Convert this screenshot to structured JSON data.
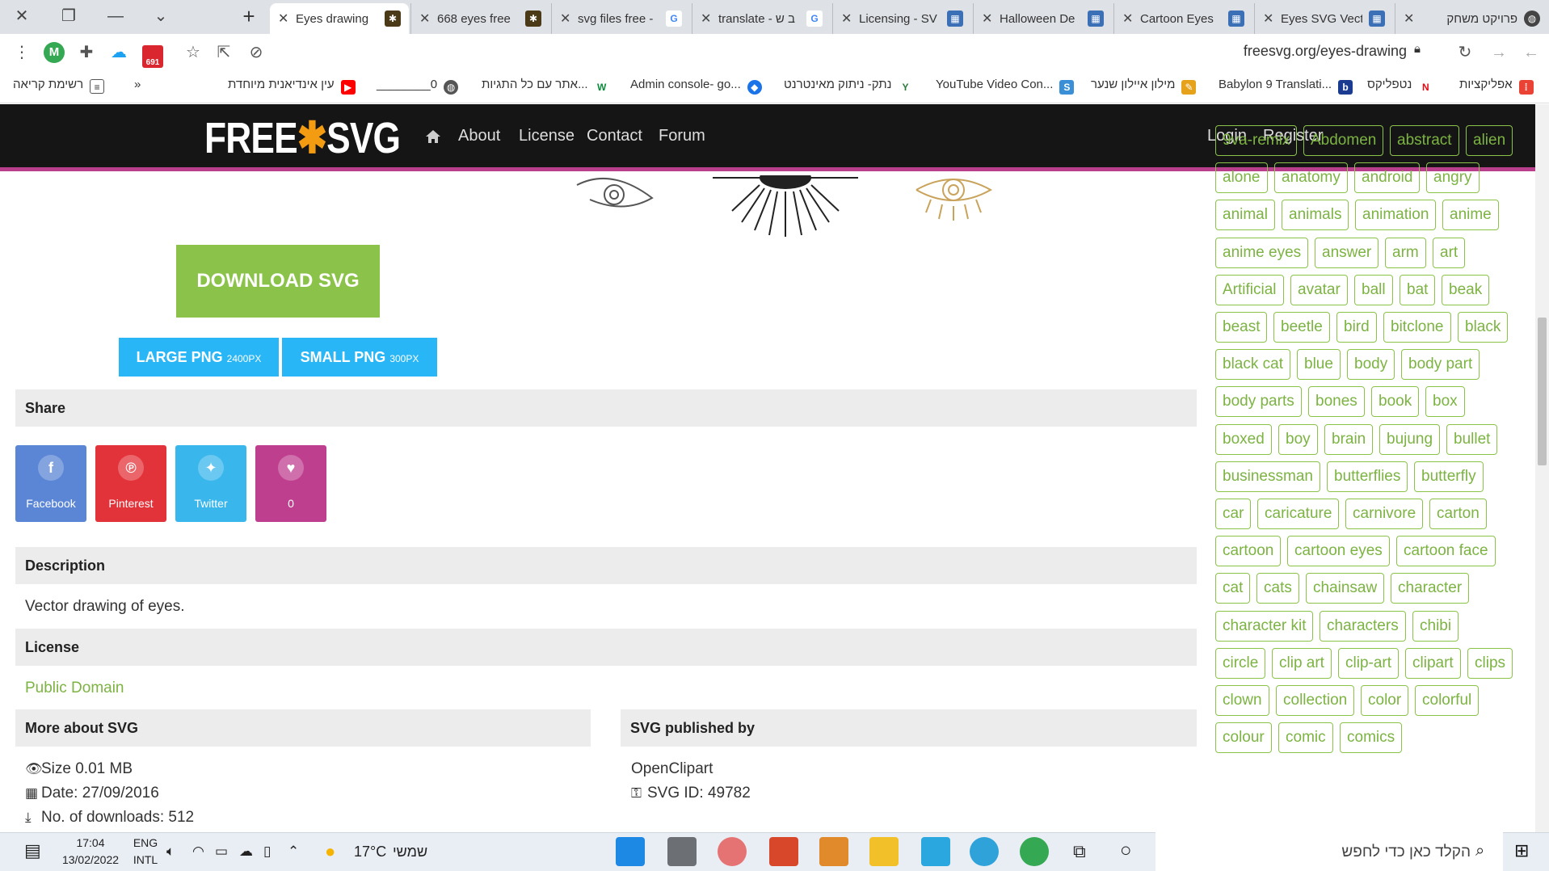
{
  "browser": {
    "tabs": [
      {
        "title": "Eyes drawing",
        "active": true
      },
      {
        "title": "668 eyes free",
        "active": false
      },
      {
        "title": "svg files free -",
        "active": false
      },
      {
        "title": "translate - ב ש",
        "active": false
      },
      {
        "title": "Licensing - SV",
        "active": false
      },
      {
        "title": "Halloween De",
        "active": false
      },
      {
        "title": "Cartoon Eyes",
        "active": false
      },
      {
        "title": "Eyes SVG Vect",
        "active": false
      },
      {
        "title": "פרויקט משחק",
        "active": false
      }
    ],
    "url": "freesvg.org/eyes-drawing",
    "extension_badge": "691",
    "profile_letter": "M",
    "bookmarks": [
      {
        "label": "אפליקציות"
      },
      {
        "label": "נטפליקס"
      },
      {
        "label": "Babylon 9 Translati..."
      },
      {
        "label": "מילון איילון שנער"
      },
      {
        "label": "YouTube Video Con..."
      },
      {
        "label": "נתק- ניתוק מאינטרנט"
      },
      {
        "label": "Admin console- go..."
      },
      {
        "label": "אתר עם כל התגיות..."
      },
      {
        "label": "________0"
      },
      {
        "label": "עין אינדיאנית מיוחדת"
      },
      {
        "label": "»"
      },
      {
        "label": "רשימת קריאה"
      }
    ]
  },
  "site": {
    "logo_left": "FREE",
    "logo_star": "✱",
    "logo_right": "SVG",
    "nav": {
      "about": "About",
      "license": "License",
      "contact": "Contact",
      "forum": "Forum",
      "login": "Login",
      "register": "Register"
    }
  },
  "downloads": {
    "download_svg": "DOWNLOAD SVG",
    "large_png": "LARGE PNG",
    "large_png_size": "2400PX",
    "small_png": "SMALL PNG",
    "small_png_size": "300PX"
  },
  "share": {
    "heading": "Share",
    "facebook": "Facebook",
    "pinterest": "Pinterest",
    "twitter": "Twitter",
    "likes": "0"
  },
  "description": {
    "heading": "Description",
    "text": "Vector drawing of eyes."
  },
  "license": {
    "heading": "License",
    "value": "Public Domain"
  },
  "more_about": {
    "heading": "More about SVG",
    "size": "Size 0.01 MB",
    "date": "Date: 27/09/2016",
    "downloads": "No. of downloads: 512"
  },
  "published_by": {
    "heading": "SVG published by",
    "author": "OpenClipart",
    "svg_id": "SVG ID: 49782"
  },
  "tags": [
    "9va-remix",
    "Abdomen",
    "abstract",
    "alien",
    "alone",
    "anatomy",
    "android",
    "angry",
    "animal",
    "animals",
    "animation",
    "anime",
    "anime eyes",
    "answer",
    "arm",
    "art",
    "Artificial",
    "avatar",
    "ball",
    "bat",
    "beak",
    "beast",
    "beetle",
    "bird",
    "bitclone",
    "black",
    "black cat",
    "blue",
    "body",
    "body part",
    "body parts",
    "bones",
    "book",
    "box",
    "boxed",
    "boy",
    "brain",
    "bujung",
    "bullet",
    "businessman",
    "butterflies",
    "butterfly",
    "car",
    "caricature",
    "carnivore",
    "carton",
    "cartoon",
    "cartoon eyes",
    "cartoon face",
    "cat",
    "cats",
    "chainsaw",
    "character",
    "character kit",
    "characters",
    "chibi",
    "circle",
    "clip art",
    "clip-art",
    "clipart",
    "clips",
    "clown",
    "collection",
    "color",
    "colorful",
    "colour",
    "comic",
    "comics"
  ],
  "taskbar": {
    "time": "17:04",
    "date": "13/02/2022",
    "lang_top": "ENG",
    "lang_bottom": "INTL",
    "weather": "17°C",
    "weather_label": "שמשי",
    "search_placeholder": "הקלד כאן כדי לחפש"
  }
}
